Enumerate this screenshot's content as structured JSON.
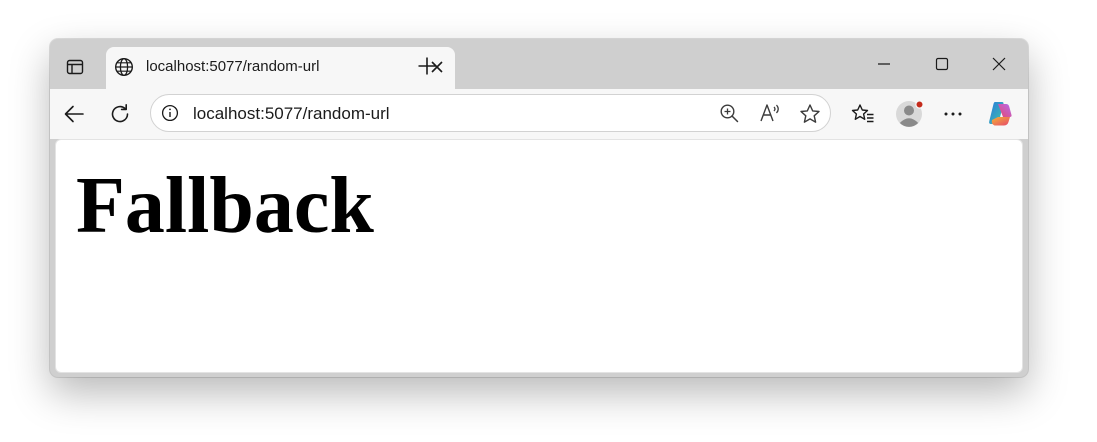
{
  "browser": {
    "tab": {
      "title": "localhost:5077/random-url",
      "favicon": "globe-icon"
    },
    "address_bar": {
      "url": "localhost:5077/random-url",
      "site_info_icon": "info-icon"
    },
    "toolbar_icons": [
      "back-icon",
      "refresh-icon",
      "zoom-icon",
      "read-aloud-icon",
      "favorite-star-icon",
      "favorites-icon",
      "profile-avatar",
      "more-icon",
      "copilot-icon"
    ],
    "window_controls": [
      "minimize-icon",
      "maximize-icon",
      "close-icon"
    ],
    "colors": {
      "titlebar": "#cfcfcf",
      "toolbar": "#f7f7f7",
      "notification_dot": "#c42b1c"
    }
  },
  "page": {
    "heading": "Fallback"
  }
}
